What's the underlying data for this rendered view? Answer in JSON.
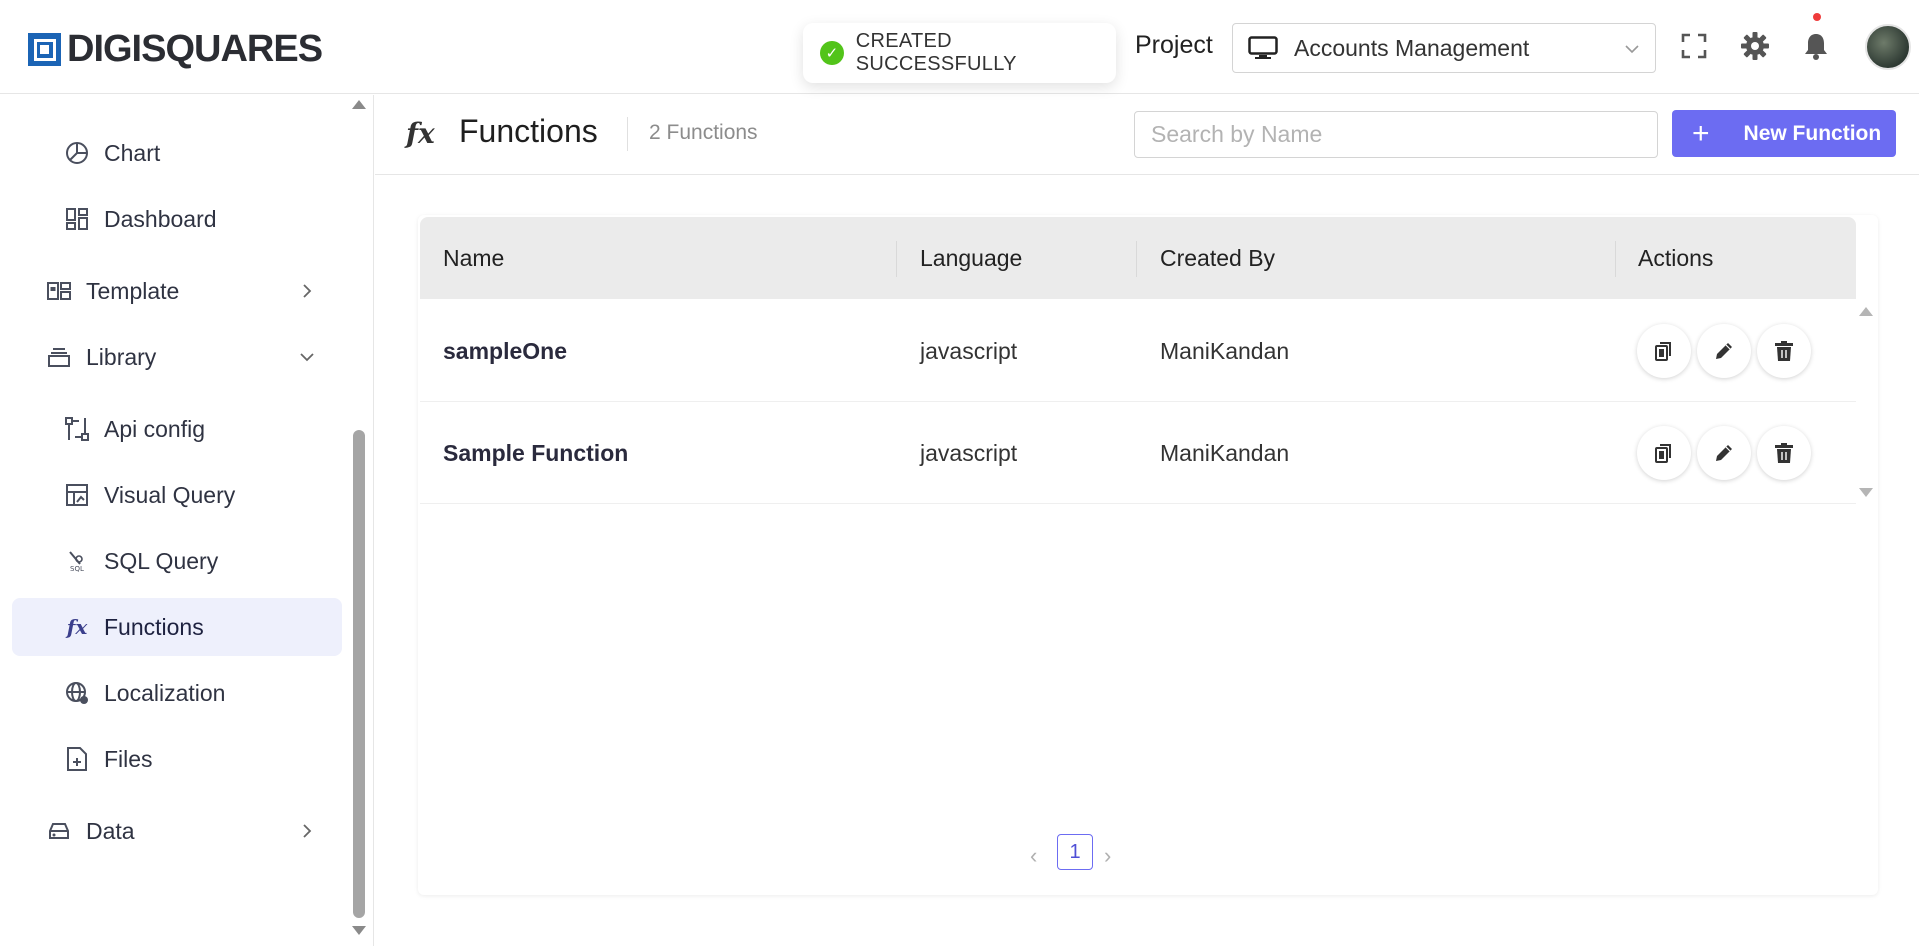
{
  "brand": {
    "name": "DIGISQUARES"
  },
  "toast": {
    "message": "CREATED SUCCESSFULLY",
    "status_color": "#52c41a"
  },
  "header": {
    "project_label": "Project",
    "project_value": "Accounts Management",
    "icons": [
      "fullscreen-icon",
      "gear-icon",
      "bell-icon",
      "avatar"
    ]
  },
  "sidebar": {
    "items": [
      {
        "label": "Chart",
        "icon": "pie-chart-icon"
      },
      {
        "label": "Dashboard",
        "icon": "dashboard-icon"
      },
      {
        "label": "Template",
        "icon": "template-icon"
      },
      {
        "label": "Library",
        "icon": "library-icon"
      },
      {
        "label": "Api config",
        "icon": "api-config-icon"
      },
      {
        "label": "Visual Query",
        "icon": "visual-query-icon"
      },
      {
        "label": "SQL Query",
        "icon": "sql-query-icon"
      },
      {
        "label": "Functions",
        "icon": "fx-icon",
        "active": true
      },
      {
        "label": "Localization",
        "icon": "globe-icon"
      },
      {
        "label": "Files",
        "icon": "file-icon"
      },
      {
        "label": "Data",
        "icon": "data-icon"
      }
    ]
  },
  "page": {
    "title": "Functions",
    "count": "2 Functions",
    "search_placeholder": "Search by Name",
    "new_button": "New Function",
    "accent": "#6c6cf2"
  },
  "table": {
    "columns": [
      "Name",
      "Language",
      "Created By",
      "Actions"
    ],
    "rows": [
      {
        "name": "sampleOne",
        "language": "javascript",
        "created_by": "ManiKandan"
      },
      {
        "name": "Sample Function",
        "language": "javascript",
        "created_by": "ManiKandan"
      }
    ]
  },
  "pagination": {
    "current": "1"
  }
}
